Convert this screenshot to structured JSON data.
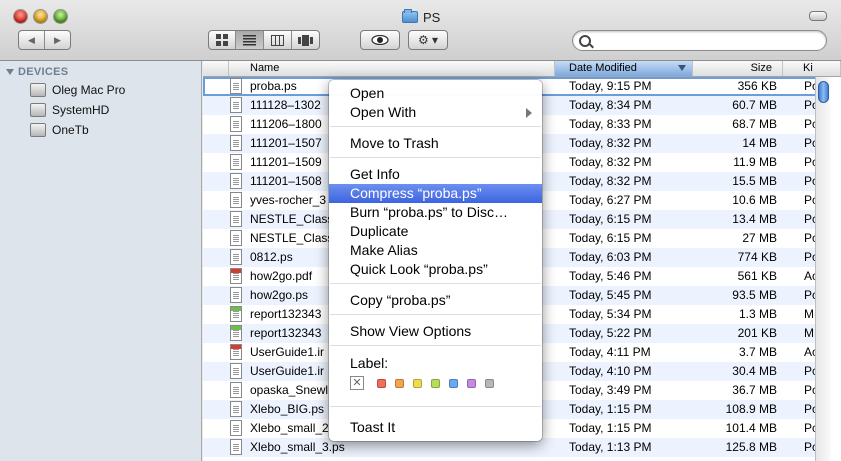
{
  "window": {
    "title": "PS"
  },
  "toolbar": {
    "back_label": "◀",
    "forward_label": "▶",
    "view_icon": "icon-view",
    "list_view": "list-view",
    "column_view": "column-view",
    "coverflow_view": "coverflow-view",
    "quicklook_label": "👁",
    "action_label": "⚙ ▾",
    "search_placeholder": ""
  },
  "sidebar": {
    "heading": "DEVICES",
    "items": [
      {
        "label": "Oleg  Mac Pro"
      },
      {
        "label": "SystemHD"
      },
      {
        "label": "OneTb"
      }
    ]
  },
  "columns": {
    "name": "Name",
    "date": "Date Modified",
    "size": "Size",
    "kind": "Ki"
  },
  "rows": [
    {
      "name": "proba.ps",
      "date": "Today, 9:15 PM",
      "size": "356 KB",
      "kind": "Pc",
      "icon": "doc"
    },
    {
      "name": "111128–1302",
      "date": "Today, 8:34 PM",
      "size": "60.7 MB",
      "kind": "Pc",
      "icon": "doc"
    },
    {
      "name": "111206–1800",
      "date": "Today, 8:33 PM",
      "size": "68.7 MB",
      "kind": "Pc",
      "icon": "doc"
    },
    {
      "name": "111201–1507",
      "date": "Today, 8:32 PM",
      "size": "14 MB",
      "kind": "Pc",
      "icon": "doc"
    },
    {
      "name": "111201–1509",
      "date": "Today, 8:32 PM",
      "size": "11.9 MB",
      "kind": "Pc",
      "icon": "doc"
    },
    {
      "name": "111201–1508",
      "date": "Today, 8:32 PM",
      "size": "15.5 MB",
      "kind": "Pc",
      "icon": "doc"
    },
    {
      "name": "yves-rocher_3",
      "date": "Today, 6:27 PM",
      "size": "10.6 MB",
      "kind": "Pc",
      "icon": "doc"
    },
    {
      "name": "NESTLE_Class",
      "date": "Today, 6:15 PM",
      "size": "13.4 MB",
      "kind": "Pc",
      "icon": "doc"
    },
    {
      "name": "NESTLE_Class",
      "date": "Today, 6:15 PM",
      "size": "27 MB",
      "kind": "Pc",
      "icon": "doc"
    },
    {
      "name": "0812.ps",
      "date": "Today, 6:03 PM",
      "size": "774 KB",
      "kind": "Pc",
      "icon": "doc"
    },
    {
      "name": "how2go.pdf",
      "date": "Today, 5:46 PM",
      "size": "561 KB",
      "kind": "Ac",
      "icon": "pdf"
    },
    {
      "name": "how2go.ps",
      "date": "Today, 5:45 PM",
      "size": "93.5 MB",
      "kind": "Pc",
      "icon": "doc"
    },
    {
      "name": "report132343",
      "date": "Today, 5:34 PM",
      "size": "1.3 MB",
      "kind": "M",
      "icon": "green"
    },
    {
      "name": "report132343",
      "date": "Today, 5:22 PM",
      "size": "201 KB",
      "kind": "M",
      "icon": "green"
    },
    {
      "name": "UserGuide1.ir",
      "date": "Today, 4:11 PM",
      "size": "3.7 MB",
      "kind": "Ac",
      "icon": "pdf"
    },
    {
      "name": "UserGuide1.ir",
      "date": "Today, 4:10 PM",
      "size": "30.4 MB",
      "kind": "Pc",
      "icon": "doc"
    },
    {
      "name": "opaska_Snewl",
      "date": "Today, 3:49 PM",
      "size": "36.7 MB",
      "kind": "Pc",
      "icon": "doc"
    },
    {
      "name": "Xlebo_BIG.ps",
      "date": "Today, 1:15 PM",
      "size": "108.9 MB",
      "kind": "Pc",
      "icon": "doc"
    },
    {
      "name": "Xlebo_small_2",
      "date": "Today, 1:15 PM",
      "size": "101.4 MB",
      "kind": "Pc",
      "icon": "doc"
    },
    {
      "name": "Xlebo_small_3.ps",
      "date": "Today, 1:13 PM",
      "size": "125.8 MB",
      "kind": "Pc",
      "icon": "doc"
    }
  ],
  "context_menu": {
    "open": "Open",
    "open_with": "Open With",
    "move_to_trash": "Move to Trash",
    "get_info": "Get Info",
    "compress": "Compress “proba.ps”",
    "burn": "Burn “proba.ps” to Disc…",
    "duplicate": "Duplicate",
    "make_alias": "Make Alias",
    "quick_look": "Quick Look “proba.ps”",
    "copy": "Copy “proba.ps”",
    "show_view_options": "Show View Options",
    "label_heading": "Label:",
    "label_none": "✕",
    "label_colors": [
      "#f26b5b",
      "#f6a44c",
      "#f0db4f",
      "#b5dd59",
      "#6aa9f2",
      "#c58be0",
      "#b7b7b7"
    ],
    "toast_it": "Toast It"
  },
  "colors": {
    "selection": "#3d64e0",
    "sidebar_bg": "#dde4ec",
    "alt_row": "#edf3fe"
  }
}
